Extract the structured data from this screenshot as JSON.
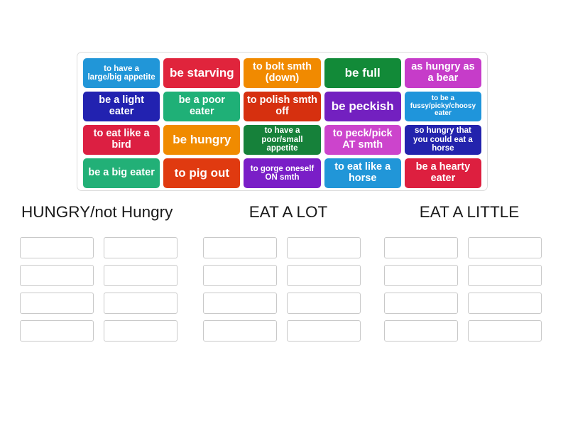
{
  "tile_bank": {
    "rows": [
      [
        {
          "label": "to have a large/big appetite",
          "color": "#2196d8",
          "size": "fs-sm"
        },
        {
          "label": "be starving",
          "color": "#e0243c",
          "size": "fs-lg"
        },
        {
          "label": "to bolt smth (down)",
          "color": "#f18a00",
          "size": "fs-md"
        },
        {
          "label": "be full",
          "color": "#128a38",
          "size": "fs-lg"
        },
        {
          "label": "as hungry as a bear",
          "color": "#c63cc9",
          "size": "fs-md"
        }
      ],
      [
        {
          "label": "be a light eater",
          "color": "#2222b0",
          "size": "fs-md"
        },
        {
          "label": "be a poor eater",
          "color": "#1fb077",
          "size": "fs-md"
        },
        {
          "label": "to polish smth off",
          "color": "#d6300f",
          "size": "fs-md"
        },
        {
          "label": "be peckish",
          "color": "#7320c0",
          "size": "fs-lg"
        },
        {
          "label": "to be a fussy/picky/choosy eater",
          "color": "#1f95db",
          "size": "fs-xs"
        }
      ],
      [
        {
          "label": "to eat like a bird",
          "color": "#dc1f42",
          "size": "fs-md"
        },
        {
          "label": "be hungry",
          "color": "#f08b00",
          "size": "fs-lg"
        },
        {
          "label": "to have a poor/small appetite",
          "color": "#16813a",
          "size": "fs-sm"
        },
        {
          "label": "to peck/pick AT smth",
          "color": "#cc44cc",
          "size": "fs-md"
        },
        {
          "label": "so hungry that you could eat a horse",
          "color": "#2323ad",
          "size": "fs-sm"
        }
      ],
      [
        {
          "label": "be a big eater",
          "color": "#22b077",
          "size": "fs-md"
        },
        {
          "label": "to pig out",
          "color": "#e03a10",
          "size": "fs-lg"
        },
        {
          "label": "to gorge oneself ON smth",
          "color": "#7a1ec7",
          "size": "fs-sm"
        },
        {
          "label": "to eat like a horse",
          "color": "#2196d8",
          "size": "fs-md"
        },
        {
          "label": "be a hearty eater",
          "color": "#dd1f3f",
          "size": "fs-md"
        }
      ]
    ]
  },
  "categories": [
    {
      "title": "HUNGRY/not Hungry",
      "slots": [
        "",
        "",
        "",
        "",
        "",
        "",
        "",
        ""
      ]
    },
    {
      "title": "EAT A LOT",
      "slots": [
        "",
        "",
        "",
        "",
        "",
        "",
        "",
        ""
      ]
    },
    {
      "title": "EAT A LITTLE",
      "slots": [
        "",
        "",
        "",
        "",
        "",
        "",
        "",
        ""
      ]
    }
  ]
}
